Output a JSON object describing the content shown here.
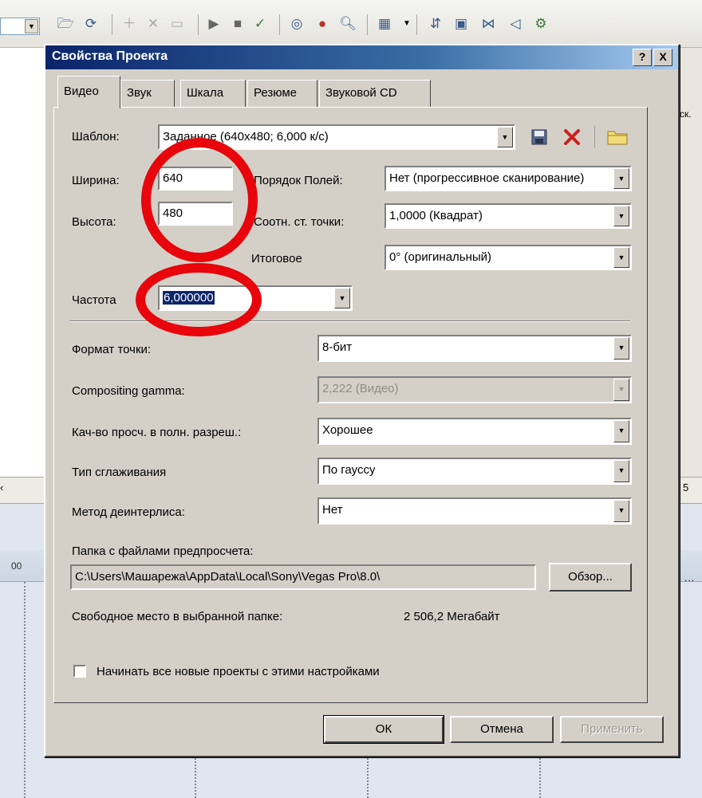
{
  "dialog": {
    "title": "Свойства Проекта",
    "help_button": "?",
    "close_button": "X",
    "tabs": [
      {
        "label": "Видео",
        "active": true
      },
      {
        "label": "Звук",
        "active": false
      },
      {
        "label": "Шкала",
        "active": false
      },
      {
        "label": "Резюме",
        "active": false
      },
      {
        "label": "Звуковой CD",
        "active": false
      }
    ],
    "video": {
      "template_label": "Шаблон:",
      "template_value": "Заданное (640x480; 6,000 к/с)",
      "width_label": "Ширина:",
      "width_value": "640",
      "height_label": "Высота:",
      "height_value": "480",
      "field_order_label": "Порядок Полей:",
      "field_order_value": "Нет (прогрессивное сканирование)",
      "pixel_aspect_label": "Соотн. ст. точки:",
      "pixel_aspect_value": "1,0000 (Квадрат)",
      "output_rotation_label": "Итоговое",
      "output_rotation_value": "0° (оригинальный)",
      "frame_rate_label": "Частота",
      "frame_rate_value": "6,000000",
      "pixel_format_label": "Формат точки:",
      "pixel_format_value": "8-бит",
      "compositing_gamma_label": "Compositing gamma:",
      "compositing_gamma_value": "2,222 (Видео)",
      "preview_quality_label": "Кач-во просч. в полн. разреш.:",
      "preview_quality_value": "Хорошее",
      "blur_type_label": "Тип сглаживания",
      "blur_type_value": "По гауссу",
      "deinterlace_label": "Метод деинтерлиса:",
      "deinterlace_value": "Нет",
      "prerender_folder_label": "Папка с файлами предпросчета:",
      "prerender_folder_value": "C:\\Users\\Машарежа\\AppData\\Local\\Sony\\Vegas Pro\\8.0\\",
      "browse_button": "Обзор...",
      "free_space_label": "Свободное место в выбранной папке:",
      "free_space_value": "2 506,2 Мегабайт",
      "start_all_projects_label": "Начинать все новые проекты с этими настройками",
      "start_all_projects_checked": false
    },
    "buttons": {
      "ok": "ОК",
      "cancel": "Отмена",
      "apply": "Применить"
    }
  },
  "host": {
    "right_label": "ск.",
    "scroll_left_arrow": "‹",
    "scroll_right_digit": "5",
    "ruler_label": "00",
    "ruler_dots": "...",
    "accent_red": "#e8050b",
    "title_gradient_start": "#0a246a"
  },
  "icons": [
    "save-icon",
    "delete-icon",
    "folder-icon",
    "dropdown-arrow-icon"
  ]
}
